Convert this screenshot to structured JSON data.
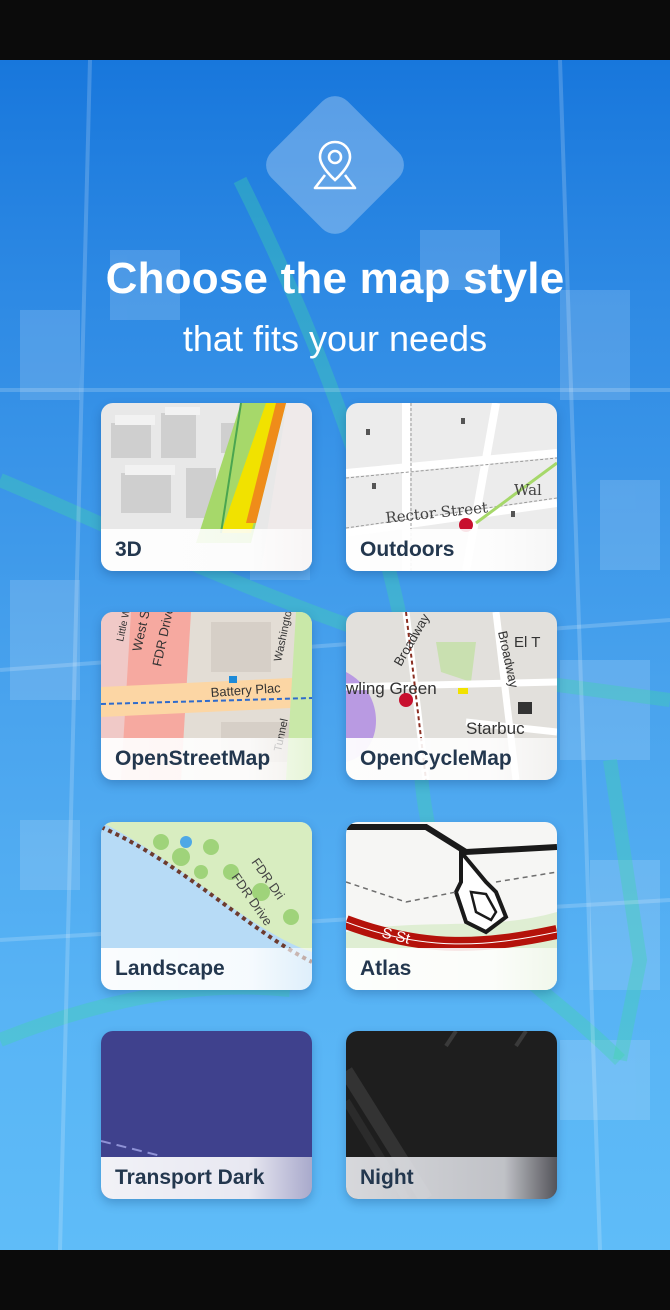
{
  "screen": {
    "headline": "Choose the map style",
    "subline": "that fits your needs",
    "logo_icon": "map-pin-icon"
  },
  "styles": [
    {
      "id": "3d",
      "label": "3D"
    },
    {
      "id": "outdoors",
      "label": "Outdoors"
    },
    {
      "id": "openstreetmap",
      "label": "OpenStreetMap"
    },
    {
      "id": "opencyclemap",
      "label": "OpenCycleMap"
    },
    {
      "id": "landscape",
      "label": "Landscape"
    },
    {
      "id": "atlas",
      "label": "Atlas"
    },
    {
      "id": "transport-dark",
      "label": "Transport Dark"
    },
    {
      "id": "night",
      "label": "Night"
    }
  ],
  "thumb_text": {
    "outdoors_street": "Rector Street",
    "outdoors_partial": "Wal",
    "osm_street1": "West Street",
    "osm_street2": "FDR Drive",
    "osm_street3": "Battery Plac",
    "osm_street4": "Washington St",
    "osm_street5": "Little West",
    "osm_street6": "Tunnel",
    "ocm_street1": "Broadway",
    "ocm_street2": "wling Green",
    "ocm_street3": "Starbuc",
    "ocm_street4": "El T",
    "ocm_street5": "Broadway",
    "land_street1": "FDR Dri",
    "land_street2": "FDR Drive",
    "atlas_street": "S St"
  },
  "colors": {
    "background_top": "#1877dc",
    "background_bottom": "#5fbcf8",
    "label_text": "#23374e",
    "transport_dark": "#3f418d",
    "night": "#1e1e1e"
  }
}
